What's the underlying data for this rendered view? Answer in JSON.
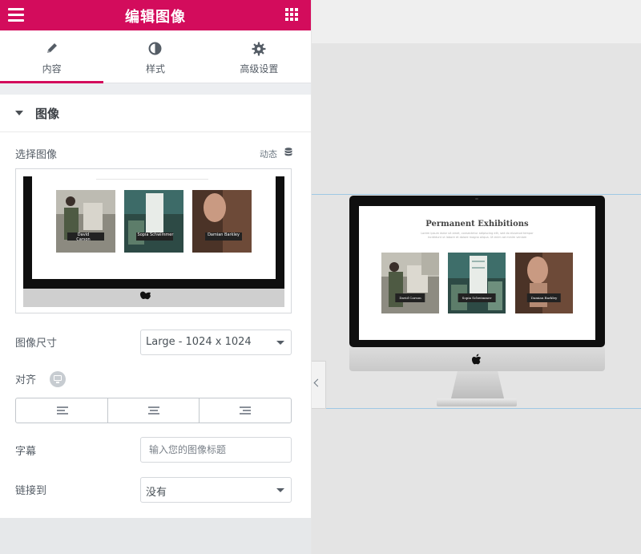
{
  "header": {
    "title": "编辑图像"
  },
  "tabs": [
    {
      "label": "内容",
      "icon": "pencil-icon",
      "active": true
    },
    {
      "label": "样式",
      "icon": "contrast-icon",
      "active": false
    },
    {
      "label": "高级设置",
      "icon": "gear-icon",
      "active": false
    }
  ],
  "section": {
    "title": "图像"
  },
  "controls": {
    "choose_image_label": "选择图像",
    "dynamic_label": "动态",
    "image_size_label": "图像尺寸",
    "image_size_value": "Large - 1024 x 1024",
    "align_label": "对齐",
    "caption_label": "字幕",
    "caption_placeholder": "输入您的图像标题",
    "link_label": "链接到",
    "link_value": "没有"
  },
  "preview": {
    "title": "Permanent Exhibitions",
    "subtitle": "Lorem ipsum dolor sit amet, consectetur adipiscing elit, sed do eiusmod tempor incididunt ut labore et dolore magna aliqua. Ut enim ad minim veniam",
    "cards": [
      {
        "caption": "David Carson"
      },
      {
        "caption": "Sopia Schwimmer"
      },
      {
        "caption": "Damian Barkley"
      }
    ]
  },
  "colors": {
    "brand": "#d30c5c",
    "guide_line": "#9fc8e4"
  }
}
